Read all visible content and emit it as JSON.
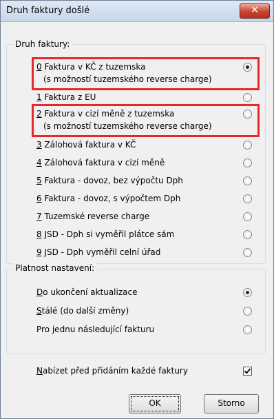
{
  "window": {
    "title": "Druh faktury došlé",
    "close_label": "✕"
  },
  "druh": {
    "legend": "Druh faktury:",
    "items": [
      {
        "key": "0",
        "label": " Faktura v KČ z tuzemska",
        "sub": "(s možností tuzemského reverse charge)",
        "selected": true
      },
      {
        "key": "1",
        "label": " Faktura z EU",
        "selected": false
      },
      {
        "key": "2",
        "label": " Faktura v cizí měně z tuzemska",
        "sub": "(s možností tuzemského reverse charge)",
        "selected": false
      },
      {
        "key": "3",
        "label": " Zálohová faktura v KČ",
        "selected": false
      },
      {
        "key": "4",
        "label": " Zálohová faktura v cizí měně",
        "selected": false
      },
      {
        "key": "5",
        "label": " Faktura - dovoz, bez výpočtu Dph",
        "selected": false
      },
      {
        "key": "6",
        "label": " Faktura - dovoz, s výpočtem Dph",
        "selected": false
      },
      {
        "key": "7",
        "label": " Tuzemské reverse charge",
        "selected": false
      },
      {
        "key": "8",
        "label": " JSD - Dph si vyměřil plátce sám",
        "selected": false
      },
      {
        "key": "9",
        "label": " JSD - Dph vyměřil celní úřad",
        "selected": false
      }
    ]
  },
  "platnost": {
    "legend": "Platnost nastavení:",
    "items": [
      {
        "key": "D",
        "label": "o ukončení aktualizace",
        "selected": true
      },
      {
        "key": "S",
        "label": "tálé (do další změny)",
        "selected": false
      },
      {
        "key": "",
        "label": "Pro jednu následující fakturu",
        "selected": false
      }
    ]
  },
  "nabizet": {
    "key": "N",
    "label": "abízet před přidáním každé faktury",
    "checked": true
  },
  "buttons": {
    "ok": "OK",
    "storno": "Storno"
  },
  "colors": {
    "highlight": "#e8262b"
  }
}
